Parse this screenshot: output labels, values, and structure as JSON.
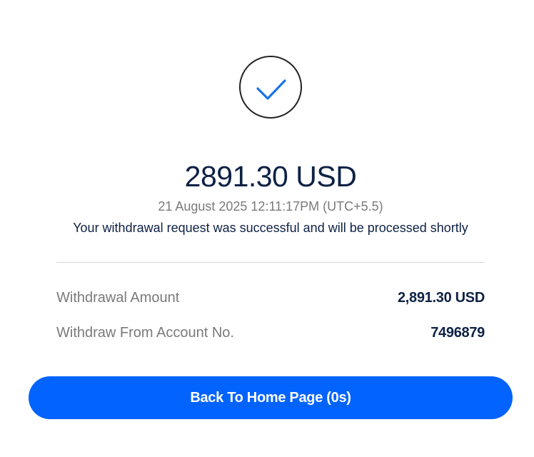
{
  "status_icon": "checkmark-circle-icon",
  "colors": {
    "accent": "#0263fe",
    "check": "#1a73e8",
    "text_dark": "#0e2145",
    "text_muted": "#7a7a7a"
  },
  "result": {
    "amount": "2891.30 USD",
    "timestamp": "21 August 2025 12:11:17PM (UTC+5.5)",
    "message": "Your withdrawal request was successful and will be processed shortly"
  },
  "details": [
    {
      "label": "Withdrawal Amount",
      "value": "2,891.30 USD"
    },
    {
      "label": "Withdraw From Account No.",
      "value": "7496879"
    }
  ],
  "actions": {
    "home_button_label": "Back To Home Page (0s)"
  }
}
